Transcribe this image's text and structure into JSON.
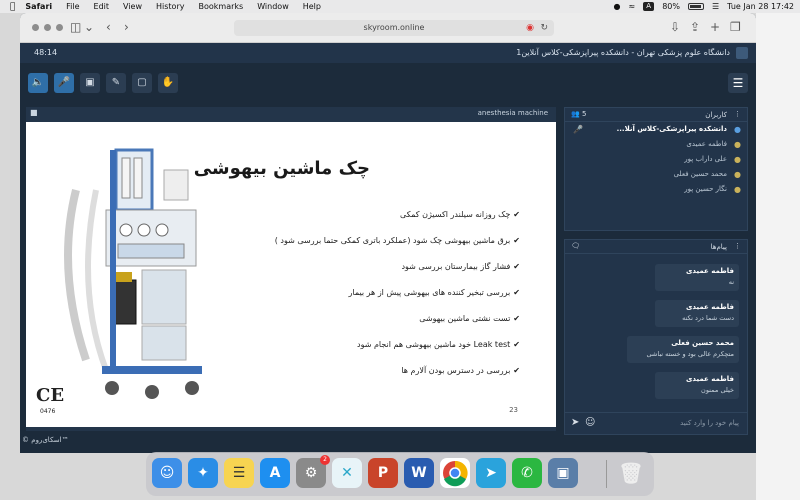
{
  "menubar": {
    "items": [
      "Safari",
      "File",
      "Edit",
      "View",
      "History",
      "Bookmarks",
      "Window",
      "Help"
    ],
    "battery": "80%",
    "clock": "Tue Jan 28  17:42"
  },
  "browser": {
    "url": "skyroom.online"
  },
  "app": {
    "timer": "48:14",
    "class_title": "دانشگاه علوم پزشکی تهران - دانشکده پیراپزشکی-کلاس آنلاین1"
  },
  "slide": {
    "panel_name": "anesthesia machine",
    "title": "چک ماشین بیهوشی",
    "bullets": [
      "چک روزانه سیلندر اکسیژن کمکی",
      "برق ماشین بیهوشی چک شود (عملکرد باتری کمکی حتما بررسی شود )",
      "فشار گاز بیمارستان بررسی شود",
      "بررسی تبخیر کننده های بیهوشی پیش از هر بیمار",
      "تست نشتی ماشین بیهوشی",
      "Leak test خود ماشین بیهوشی هم انجام شود",
      "بررسی در دسترس بودن آلارم ها"
    ],
    "page_number": "23",
    "ce_mark": "CE",
    "ce_number": "0476"
  },
  "footer": {
    "brand": "© اسکای‌روم™"
  },
  "users": {
    "label": "کاربران",
    "count": "5",
    "list": [
      {
        "name": "دانشکده پیراپزشکی-کلاس آنلا...",
        "host": true
      },
      {
        "name": "فاطمه عمیدی",
        "host": false
      },
      {
        "name": "علی داراب پور",
        "host": false
      },
      {
        "name": "محمد حسین فعلی",
        "host": false
      },
      {
        "name": "نگار حسین پور",
        "host": false
      }
    ]
  },
  "chat": {
    "label": "پیام‌ها",
    "messages": [
      {
        "sender": "فاطمه عمیدی",
        "text": "نه"
      },
      {
        "sender": "فاطمه عمیدی",
        "text": "دست شما درد نکنه"
      },
      {
        "sender": "محمد حسین فعلی",
        "text": "متچکرم عالی بود و خسته نباشی"
      },
      {
        "sender": "فاطمه عمیدی",
        "text": "خیلی ممنون"
      }
    ],
    "placeholder": "پیام خود را وارد کنید"
  },
  "dock": {
    "settings_badge": "2"
  },
  "colors": {
    "app_bg": "#1c2b3b",
    "accent": "#2f6fa8",
    "panel": "#22344a"
  }
}
